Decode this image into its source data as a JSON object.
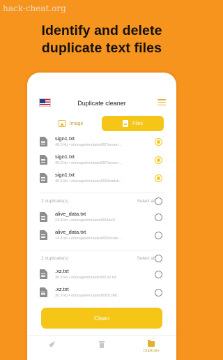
{
  "watermark": "hack-cheat.org",
  "headline": {
    "line1": "Identify and delete",
    "line2": "duplicate text files"
  },
  "app": {
    "title": "Duplicate cleaner",
    "tabs": [
      {
        "label": "Image",
        "active": false
      },
      {
        "label": "Files",
        "active": true
      }
    ],
    "groups": [
      {
        "header": null,
        "files": [
          {
            "name": "sign1.txt",
            "meta": "40.0 kb • /storage/emulated/0/Tencen…",
            "checked": true
          },
          {
            "name": "sign1.txt",
            "meta": "40.0 kb • /storage/emulated/0/Tencen…",
            "checked": true
          },
          {
            "name": "sign1.txt",
            "meta": "40.0 kb • /storage/emulated/0/Netdisk…",
            "checked": true
          }
        ]
      },
      {
        "header": {
          "count": "2 duplicate(s)",
          "select": "Select all"
        },
        "files": [
          {
            "name": "alive_data.txt",
            "meta": "24.8 kb • /storage/emulated/0/AlioD…",
            "checked": false
          },
          {
            "name": "alive_data.txt",
            "meta": "14.8 kb • /storage/emulated/0/Docum…",
            "checked": false
          }
        ]
      },
      {
        "header": {
          "count": "2 duplicate(s)",
          "select": "Select all"
        },
        "files": [
          {
            "name": ".xz.txt",
            "meta": "30.9 kb • /storage/emulated/0/.xz.txt",
            "checked": false
          },
          {
            "name": ".xz.txt",
            "meta": "30.9 kb • /storage/emulated/0/DCIM/…",
            "checked": false
          }
        ]
      }
    ],
    "clean_label": "Clean",
    "nav": [
      {
        "icon": "rocket-icon",
        "label": ""
      },
      {
        "icon": "trash-icon",
        "label": ""
      },
      {
        "icon": "folder-icon",
        "label": "Duplicate"
      }
    ]
  },
  "colors": {
    "background": "#f7941d",
    "accent": "#f5c518"
  }
}
